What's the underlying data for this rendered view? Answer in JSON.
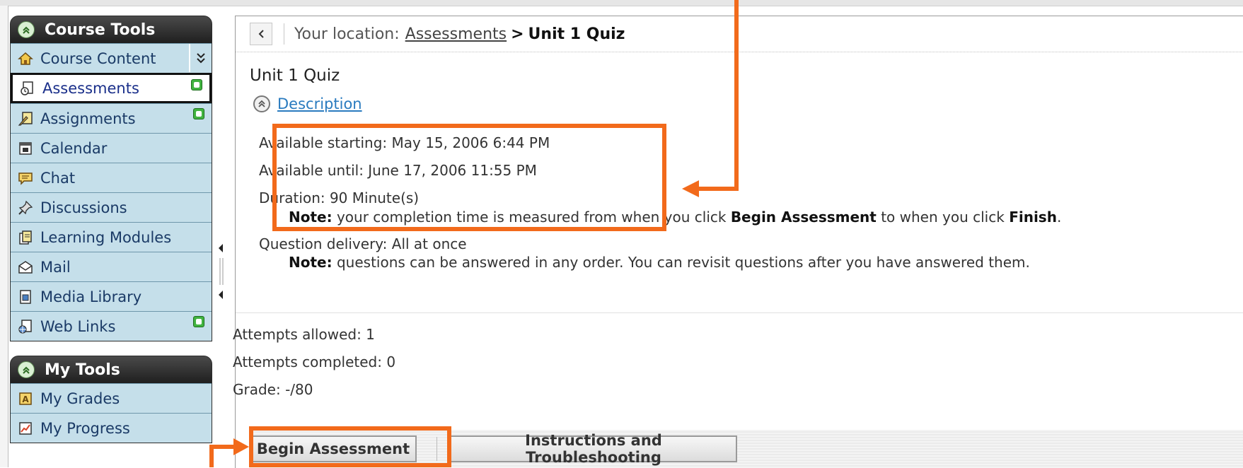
{
  "course_tools": {
    "title": "Course Tools",
    "items": [
      {
        "label": "Course Content"
      },
      {
        "label": "Assessments"
      },
      {
        "label": "Assignments"
      },
      {
        "label": "Calendar"
      },
      {
        "label": "Chat"
      },
      {
        "label": "Discussions"
      },
      {
        "label": "Learning Modules"
      },
      {
        "label": "Mail"
      },
      {
        "label": "Media Library"
      },
      {
        "label": "Web Links"
      }
    ]
  },
  "my_tools": {
    "title": "My Tools",
    "items": [
      {
        "label": "My Grades"
      },
      {
        "label": "My Progress"
      }
    ]
  },
  "location": {
    "prefix": "Your location:",
    "crumb": "Assessments",
    "separator": ">",
    "current": "Unit 1 Quiz"
  },
  "quiz": {
    "title": "Unit 1 Quiz",
    "description_link": "Description",
    "available_starting": "Available starting: May 15, 2006 6:44 PM",
    "available_until": "Available until: June 17, 2006 11:55 PM",
    "duration": "Duration: 90 Minute(s)",
    "note1_label": "Note:",
    "note1_pre": " your completion time is measured from when you click ",
    "note1_bold1": "Begin Assessment",
    "note1_mid": " to when you click ",
    "note1_bold2": "Finish",
    "note1_end": ".",
    "question_delivery": "Question delivery: All at once",
    "note2_label": "Note:",
    "note2_text": " questions can be answered in any order. You can revisit questions after you have answered them.",
    "attempts_allowed": "Attempts allowed: 1",
    "attempts_completed": "Attempts completed: 0",
    "grade": "Grade: -/80"
  },
  "buttons": {
    "begin": "Begin Assessment",
    "instructions": "Instructions and Troubleshooting"
  },
  "colors": {
    "annotation": "#f26a1b",
    "nav_bg": "#c5dfea",
    "link": "#2a7bbf"
  }
}
